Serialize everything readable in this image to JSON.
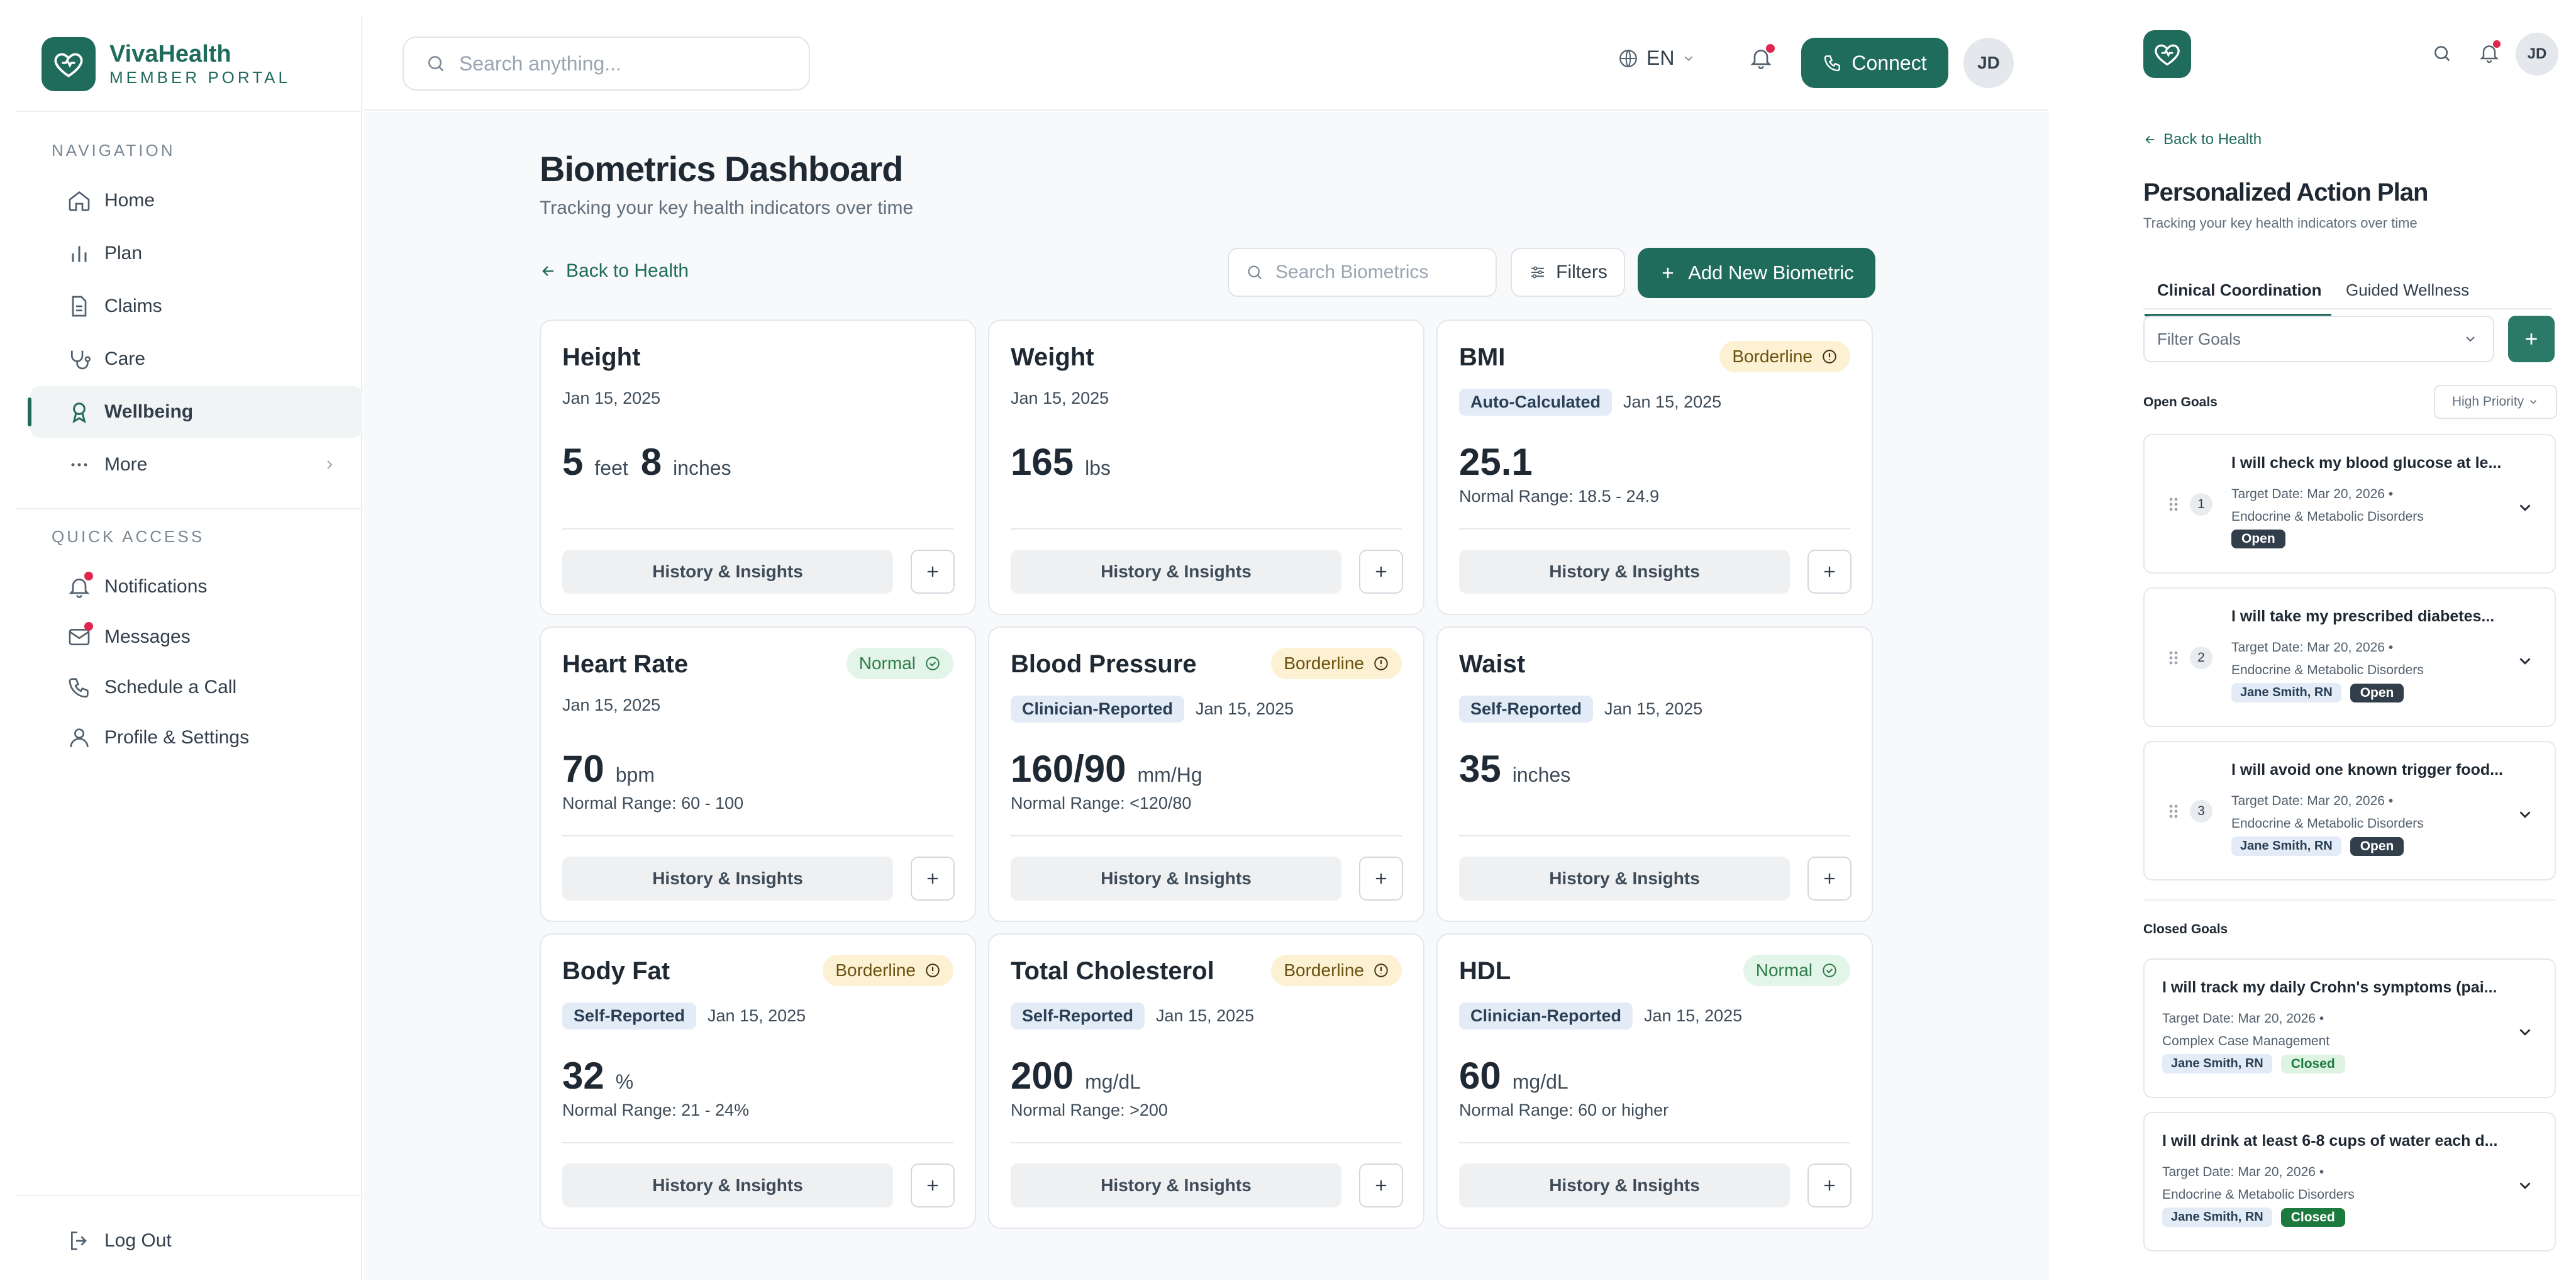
{
  "brand": {
    "name": "VivaHealth",
    "sub": "MEMBER PORTAL",
    "accent": "#1f6b5c"
  },
  "sidebar": {
    "nav_heading": "NAVIGATION",
    "nav": [
      {
        "label": "Home",
        "icon": "home-icon"
      },
      {
        "label": "Plan",
        "icon": "chart-icon"
      },
      {
        "label": "Claims",
        "icon": "document-icon"
      },
      {
        "label": "Care",
        "icon": "stethoscope-icon"
      },
      {
        "label": "Wellbeing",
        "icon": "ribbon-icon",
        "active": true
      },
      {
        "label": "More",
        "icon": "more-icon"
      }
    ],
    "quick_heading": "QUICK ACCESS",
    "quick": [
      {
        "label": "Notifications",
        "icon": "bell-icon"
      },
      {
        "label": "Messages",
        "icon": "mail-icon"
      },
      {
        "label": "Schedule a Call",
        "icon": "phone-icon"
      },
      {
        "label": "Profile & Settings",
        "icon": "user-icon"
      }
    ],
    "logout": "Log Out"
  },
  "topbar": {
    "search_placeholder": "Search anything...",
    "language": "EN",
    "connect": "Connect",
    "avatar": "JD"
  },
  "main": {
    "title": "Biometrics Dashboard",
    "subtitle": "Tracking your key health indicators over time",
    "back": "Back to Health",
    "search_placeholder": "Search Biometrics",
    "filters": "Filters",
    "add": "Add New Biometric",
    "history_label": "History & Insights",
    "cards": [
      {
        "name": "Height",
        "date": "Jan 15, 2025",
        "value": "5",
        "unit": "feet",
        "value2": "8",
        "unit2": "inches"
      },
      {
        "name": "Weight",
        "date": "Jan 15, 2025",
        "value": "165",
        "unit": "lbs"
      },
      {
        "name": "BMI",
        "date": "Jan 15, 2025",
        "source": "Auto-Calculated",
        "status": "Borderline",
        "value": "25.1",
        "range": "Normal Range: 18.5 - 24.9"
      },
      {
        "name": "Heart Rate",
        "date": "Jan 15, 2025",
        "status": "Normal",
        "value": "70",
        "unit": "bpm",
        "range": "Normal Range: 60 - 100"
      },
      {
        "name": "Blood Pressure",
        "date": "Jan 15, 2025",
        "source": "Clinician-Reported",
        "status": "Borderline",
        "value": "160/90",
        "unit": "mm/Hg",
        "range": "Normal Range: <120/80"
      },
      {
        "name": "Waist",
        "date": "Jan 15, 2025",
        "source": "Self-Reported",
        "value": "35",
        "unit": "inches"
      },
      {
        "name": "Body Fat",
        "date": "Jan 15, 2025",
        "source": "Self-Reported",
        "status": "Borderline",
        "value": "32",
        "unit": "%",
        "range": "Normal Range: 21 - 24%"
      },
      {
        "name": "Total Cholesterol",
        "date": "Jan 15, 2025",
        "source": "Self-Reported",
        "status": "Borderline",
        "value": "200",
        "unit": "mg/dL",
        "range": "Normal Range: >200"
      },
      {
        "name": "HDL",
        "date": "Jan 15, 2025",
        "source": "Clinician-Reported",
        "status": "Normal",
        "value": "60",
        "unit": "mg/dL",
        "range": "Normal Range: 60 or higher"
      }
    ]
  },
  "panel": {
    "avatar": "JD",
    "back": "Back to Health",
    "title": "Personalized Action Plan",
    "subtitle": "Tracking your key health indicators over time",
    "tabs": [
      "Clinical Coordination",
      "Guided Wellness"
    ],
    "filter_placeholder": "Filter Goals",
    "open_label": "Open Goals",
    "priority": "High Priority",
    "closed_label": "Closed Goals",
    "open_goals": [
      {
        "num": "1",
        "title": "I will check my blood glucose at le...",
        "target": "Target Date: Mar 20, 2026",
        "category": "Endocrine & Metabolic Disorders",
        "status": "Open"
      },
      {
        "num": "2",
        "title": "I will take my prescribed diabetes...",
        "target": "Target Date: Mar 20, 2026",
        "category": "Endocrine & Metabolic Disorders",
        "assignee": "Jane Smith, RN",
        "status": "Open"
      },
      {
        "num": "3",
        "title": "I will avoid one known trigger food...",
        "target": "Target Date: Mar 20, 2026",
        "category": "Endocrine & Metabolic Disorders",
        "assignee": "Jane Smith, RN",
        "status": "Open"
      }
    ],
    "closed_goals": [
      {
        "title": "I will track my daily Crohn's symptoms (pai...",
        "target": "Target Date: Mar 20, 2026",
        "category": "Complex Case Management",
        "assignee": "Jane Smith, RN",
        "status": "Closed"
      },
      {
        "title": "I will drink at least 6-8 cups of water each d...",
        "target": "Target Date: Mar 20, 2026",
        "category": "Endocrine & Metabolic Disorders",
        "assignee": "Jane Smith, RN",
        "status": "Closed"
      }
    ]
  }
}
